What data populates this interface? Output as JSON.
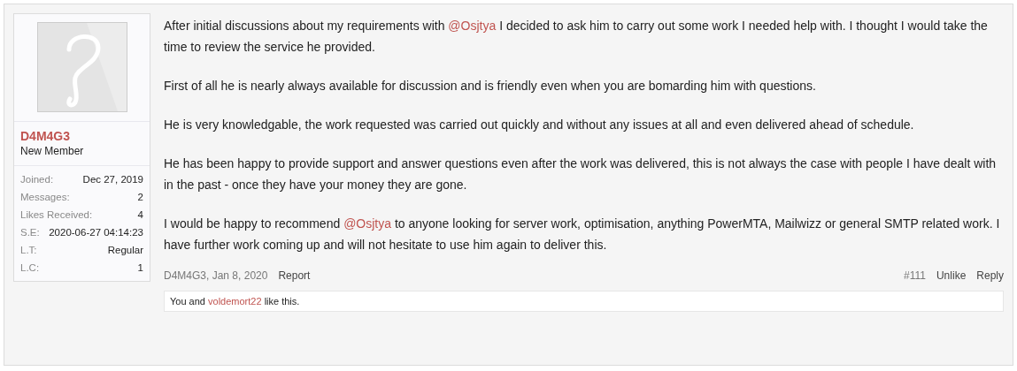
{
  "user": {
    "name": "D4M4G3",
    "title": "New Member",
    "stats": [
      {
        "label": "Joined:",
        "value": "Dec 27, 2019"
      },
      {
        "label": "Messages:",
        "value": "2"
      },
      {
        "label": "Likes Received:",
        "value": "4"
      },
      {
        "label": "S.E:",
        "value": "2020-06-27 04:14:23"
      },
      {
        "label": "L.T:",
        "value": "Regular"
      },
      {
        "label": "L.C:",
        "value": "1"
      }
    ]
  },
  "message": {
    "paragraphs": [
      [
        {
          "kind": "text",
          "text": "After initial discussions about my requirements with "
        },
        {
          "kind": "mention",
          "text": "@Osjtya"
        },
        {
          "kind": "text",
          "text": " I decided to ask him to carry out some work I needed help with. I thought I would take the time to review the service he provided."
        }
      ],
      [
        {
          "kind": "text",
          "text": "First of all he is nearly always available for discussion and is friendly even when you are bomarding him with questions."
        }
      ],
      [
        {
          "kind": "text",
          "text": "He is very knowledgable, the work requested was carried out quickly and without any issues at all and even delivered ahead of schedule."
        }
      ],
      [
        {
          "kind": "text",
          "text": "He has been happy to provide support and answer questions even after the work was delivered, this is not always the case with people I have dealt with in the past - once they have your money they are gone."
        }
      ],
      [
        {
          "kind": "text",
          "text": "I would be happy to recommend "
        },
        {
          "kind": "mention",
          "text": "@Osjtya"
        },
        {
          "kind": "text",
          "text": " to anyone looking for server work, optimisation, anything PowerMTA, Mailwizz or general SMTP related work. I have further work coming up and will not hesitate to use him again to deliver this."
        }
      ]
    ]
  },
  "footer": {
    "author_date": "D4M4G3, Jan 8, 2020",
    "left_links": [
      "Report"
    ],
    "post_number": "#111",
    "right_links": [
      "Unlike",
      "Reply"
    ]
  },
  "likes": [
    {
      "kind": "text",
      "text": "You and "
    },
    {
      "kind": "user",
      "text": "voldemort22"
    },
    {
      "kind": "text",
      "text": " like this."
    }
  ]
}
